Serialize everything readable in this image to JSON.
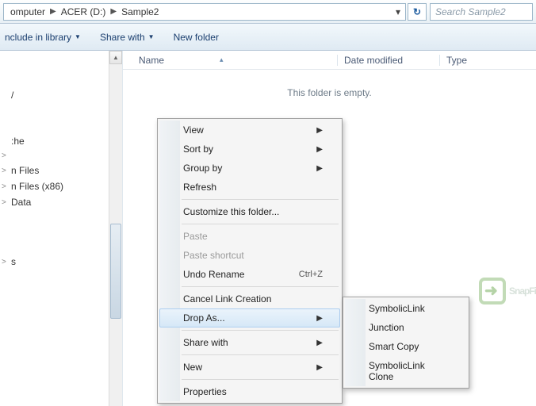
{
  "breadcrumb": {
    "items": [
      "omputer",
      "ACER (D:)",
      "Sample2"
    ]
  },
  "search": {
    "placeholder": "Search Sample2"
  },
  "toolbar": {
    "include": "nclude in library",
    "share": "Share with",
    "newfolder": "New folder"
  },
  "columns": {
    "name": "Name",
    "date": "Date modified",
    "type": "Type"
  },
  "empty_message": "This folder is empty.",
  "sidebar": {
    "items": [
      {
        "label": "",
        "expander": ""
      },
      {
        "label": "/",
        "expander": ""
      },
      {
        "label": "",
        "expander": ""
      },
      {
        "label": ":he",
        "expander": ""
      },
      {
        "label": "",
        "expander": ">"
      },
      {
        "label": "n Files",
        "expander": ">"
      },
      {
        "label": "n Files (x86)",
        "expander": ">"
      },
      {
        "label": "Data",
        "expander": ">"
      },
      {
        "label": "",
        "expander": ""
      },
      {
        "label": "",
        "expander": ""
      },
      {
        "label": "",
        "expander": ""
      },
      {
        "label": "",
        "expander": ""
      },
      {
        "label": "s",
        "expander": ">"
      }
    ]
  },
  "context_menu": {
    "view": "View",
    "sortby": "Sort by",
    "groupby": "Group by",
    "refresh": "Refresh",
    "customize": "Customize this folder...",
    "paste": "Paste",
    "paste_shortcut": "Paste shortcut",
    "undo_rename": "Undo Rename",
    "undo_shortcut": "Ctrl+Z",
    "cancel_link": "Cancel Link Creation",
    "drop_as": "Drop As...",
    "share_with": "Share with",
    "new": "New",
    "properties": "Properties"
  },
  "submenu": {
    "symlink": "SymbolicLink",
    "junction": "Junction",
    "smartcopy": "Smart Copy",
    "symlink_clone": "SymbolicLink Clone"
  },
  "watermark": "SnapFi"
}
